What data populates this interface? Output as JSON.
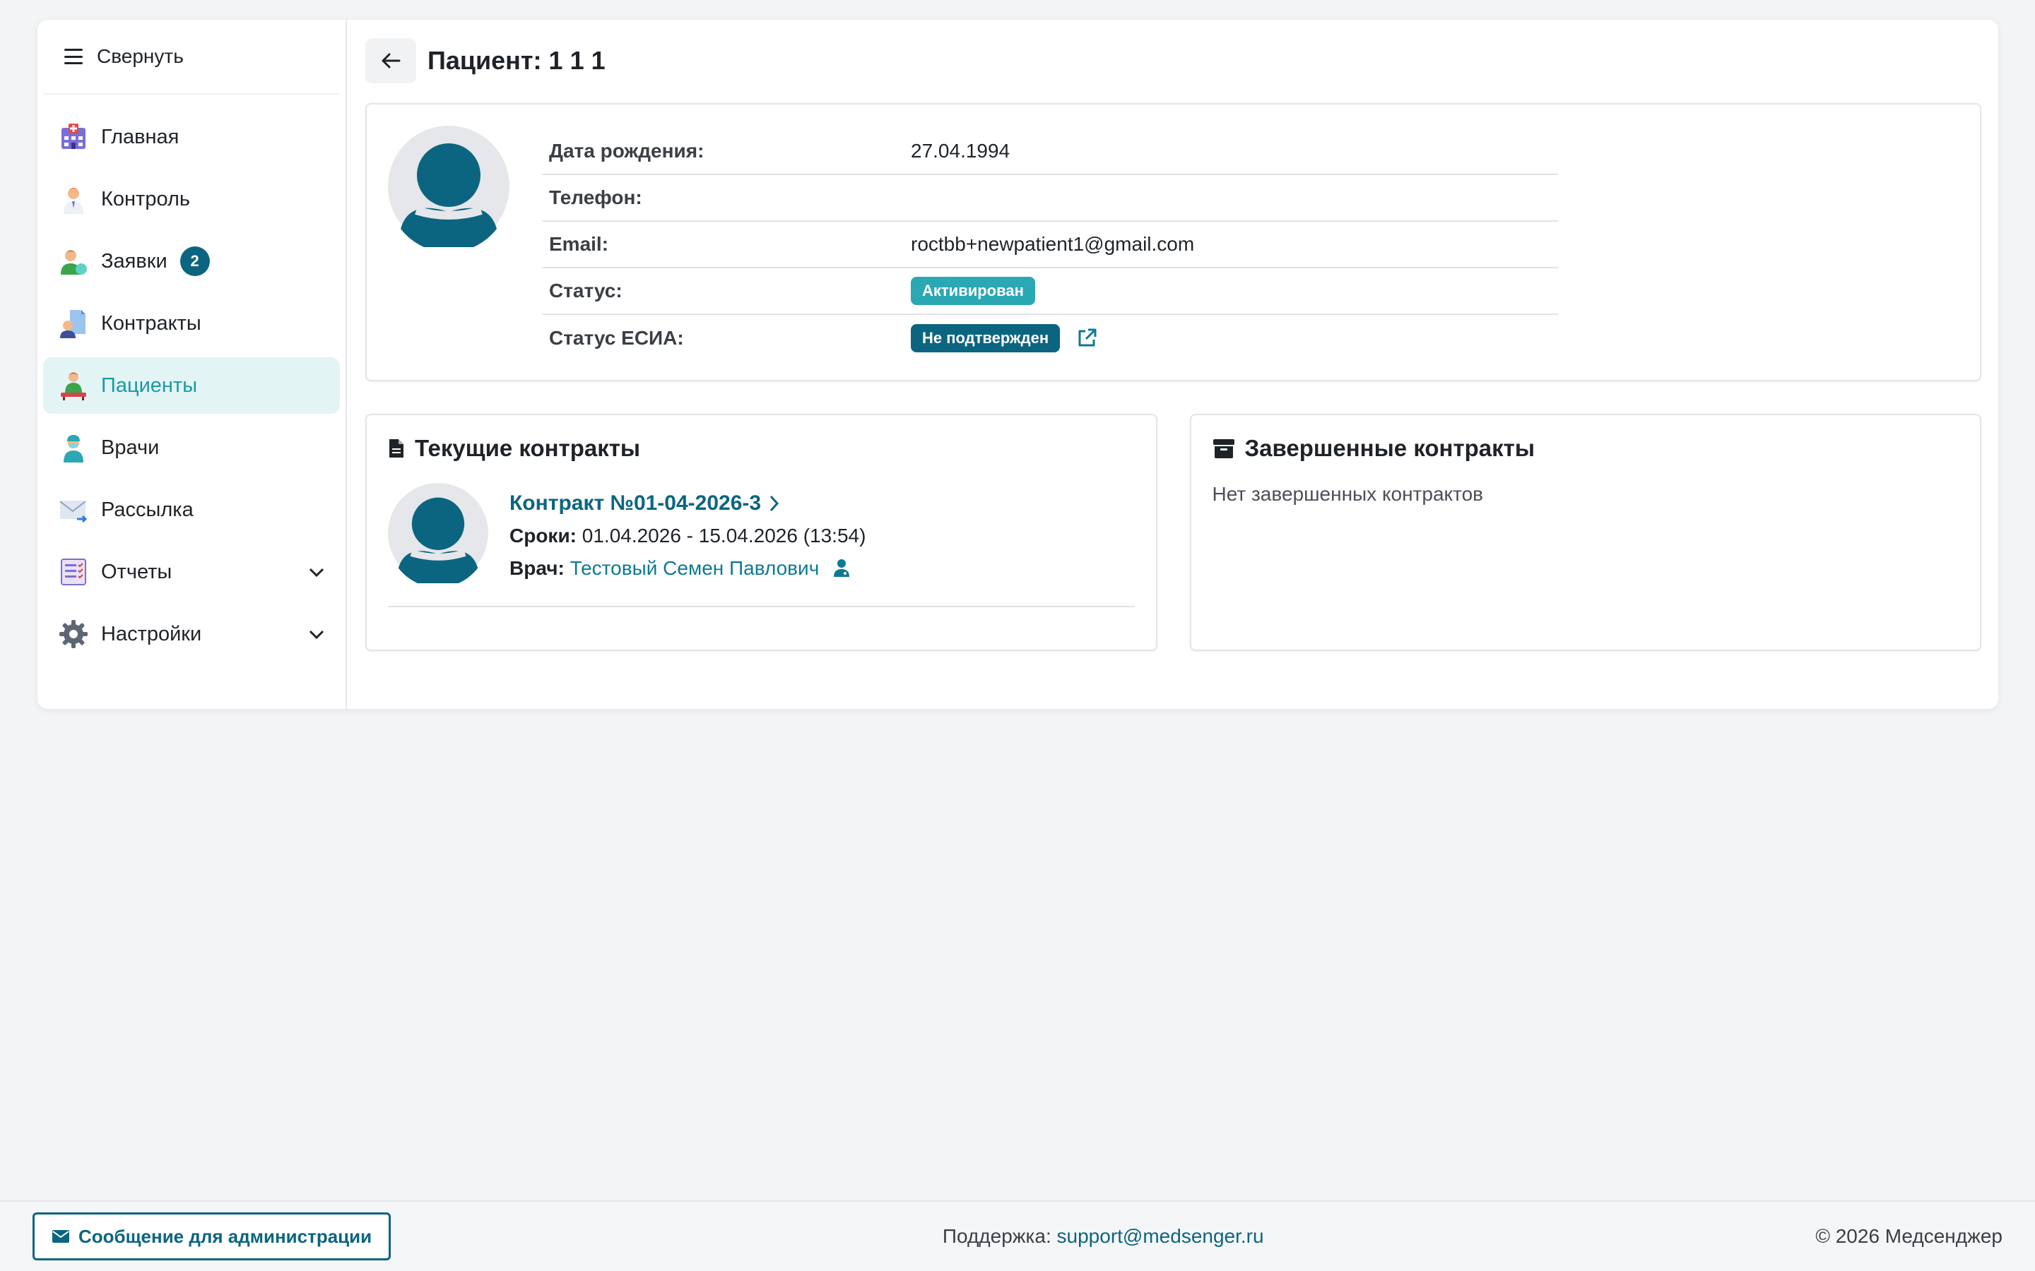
{
  "sidebar": {
    "collapse_label": "Свернуть",
    "items": [
      {
        "label": "Главная",
        "icon": "hospital-icon"
      },
      {
        "label": "Контроль",
        "icon": "doctor-icon"
      },
      {
        "label": "Заявки",
        "icon": "requests-icon",
        "badge": "2"
      },
      {
        "label": "Контракты",
        "icon": "contract-doc-icon"
      },
      {
        "label": "Пациенты",
        "icon": "patient-icon",
        "active": true
      },
      {
        "label": "Врачи",
        "icon": "medic-icon"
      },
      {
        "label": "Рассылка",
        "icon": "mail-icon"
      },
      {
        "label": "Отчеты",
        "icon": "report-icon",
        "expandable": true
      },
      {
        "label": "Настройки",
        "icon": "gear-icon",
        "expandable": true
      }
    ]
  },
  "header": {
    "title": "Пациент: 1 1 1"
  },
  "patient": {
    "rows": [
      {
        "label": "Дата рождения:",
        "value": "27.04.1994"
      },
      {
        "label": "Телефон:",
        "value": ""
      },
      {
        "label": "Email:",
        "value": "roctbb+newpatient1@gmail.com"
      },
      {
        "label": "Статус:",
        "badge": "Активирован",
        "badge_color": "#2aa8b3"
      },
      {
        "label": "Статус ЕСИА:",
        "badge": "Не подтвержден",
        "badge_color": "#0c6580"
      }
    ]
  },
  "current_contracts": {
    "title": "Текущие контракты",
    "contract": {
      "name": "Контракт №01-04-2026-3",
      "terms_label": "Сроки:",
      "terms_value": "01.04.2026 - 15.04.2026 (13:54)",
      "doctor_label": "Врач:",
      "doctor_name": "Тестовый Семен Павлович"
    }
  },
  "finished_contracts": {
    "title": "Завершенные контракты",
    "empty_text": "Нет завершенных контрактов"
  },
  "footer": {
    "admin_button": "Сообщение для администрации",
    "support_label": "Поддержка:",
    "support_email": "support@medsenger.ru",
    "copyright": "© 2026 Медсенджер"
  },
  "colors": {
    "accent": "#0c6580",
    "active_bg": "#e3f4f5",
    "active_text": "#1a9aa6"
  }
}
